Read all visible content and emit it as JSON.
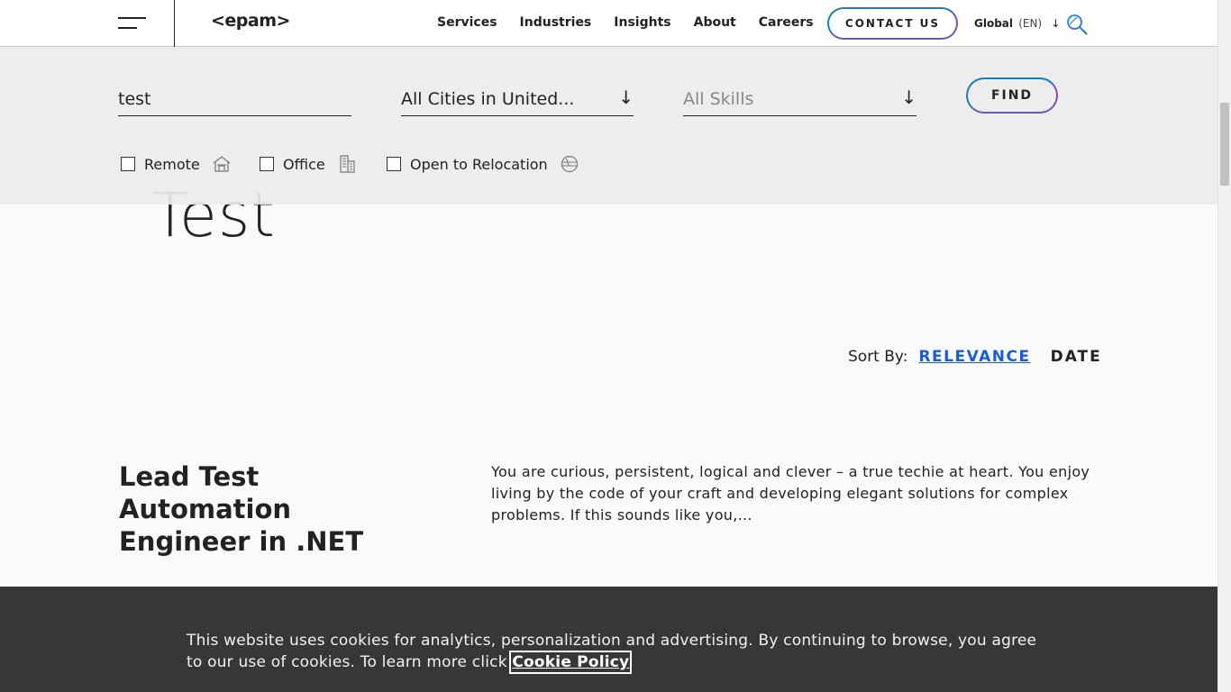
{
  "header": {
    "nav": [
      "Services",
      "Industries",
      "Insights",
      "About",
      "Careers"
    ],
    "contact_label": "CONTACT US",
    "lang_label": "Global",
    "lang_code": "(EN)"
  },
  "search": {
    "keyword_value": "test",
    "city_value": "All Cities in United...",
    "skills_placeholder": "All Skills",
    "find_label": "FIND",
    "filters": [
      "Remote",
      "Office",
      "Open to Relocation"
    ]
  },
  "page": {
    "heading": "Test"
  },
  "sort": {
    "label": "Sort By:",
    "relevance": "RELEVANCE",
    "date": "DATE"
  },
  "job": {
    "title": "Lead Test Automation Engineer in .NET",
    "description": "You are curious, persistent, logical and clever – a true techie at heart. You enjoy living by the code of your craft and developing elegant solutions for complex problems. If this sounds like you,..."
  },
  "cookie": {
    "text": "This website uses cookies for analytics, personalization and advertising. By continuing to browse, you agree to our use of cookies. To learn more click ",
    "link": "Cookie Policy"
  }
}
